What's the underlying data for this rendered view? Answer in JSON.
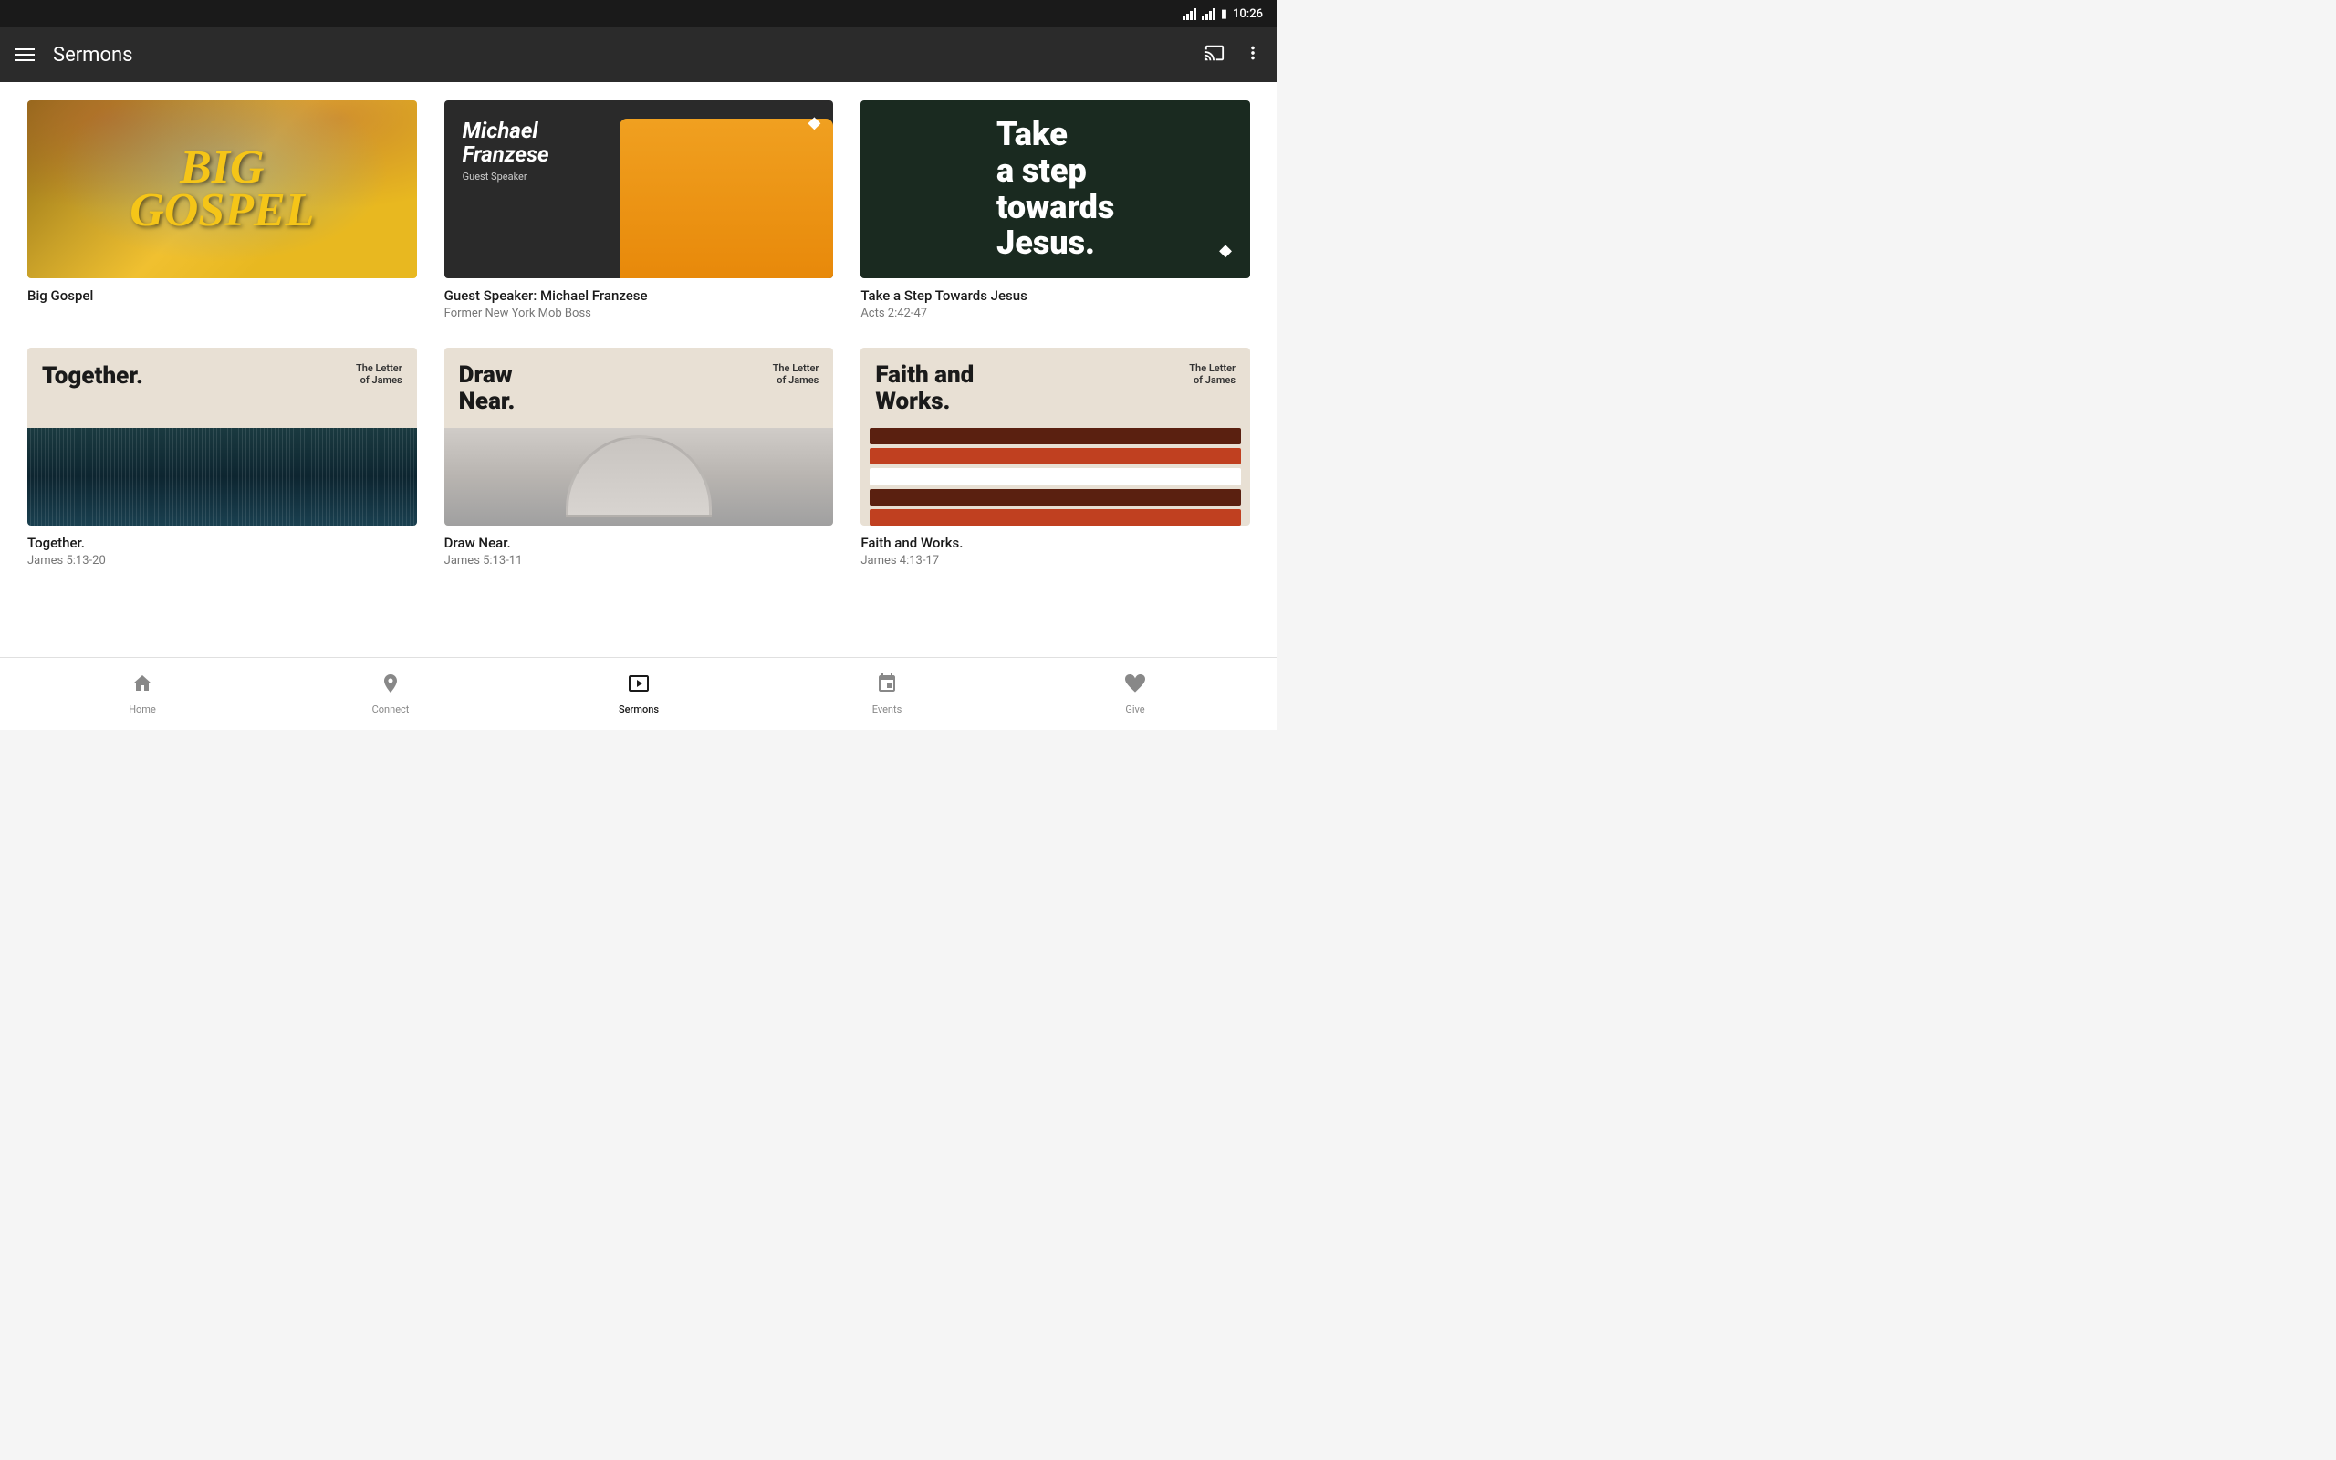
{
  "statusBar": {
    "time": "10:26"
  },
  "appBar": {
    "title": "Sermons",
    "menuIcon": "hamburger",
    "castIcon": "cast",
    "moreIcon": "more-vertical"
  },
  "sermons": [
    {
      "id": "big-gospel",
      "title": "Big Gospel",
      "subtitle": "",
      "thumbType": "big-gospel",
      "thumbText": "BIG\nGOSPEL"
    },
    {
      "id": "michael-franzese",
      "title": "Guest Speaker: Michael Franzese",
      "subtitle": "Former New York Mob Boss",
      "thumbType": "michael",
      "thumbName": "Michael\nFranzese",
      "thumbSub": "Guest Speaker"
    },
    {
      "id": "take-step-jesus",
      "title": "Take a Step Towards Jesus",
      "subtitle": "Acts 2:42-47",
      "thumbType": "step-jesus",
      "thumbText": "Take\na step\ntowards\nJesus."
    },
    {
      "id": "together",
      "title": "Together.",
      "subtitle": "James 5:13-20",
      "thumbType": "together",
      "thumbTitle": "Together.",
      "thumbSeries": "The Letter\nof James"
    },
    {
      "id": "draw-near",
      "title": "Draw Near.",
      "subtitle": "James 5:13-11",
      "thumbType": "draw-near",
      "thumbTitle": "Draw\nNear.",
      "thumbSeries": "The Letter\nof James"
    },
    {
      "id": "faith-works",
      "title": "Faith and Works.",
      "subtitle": "James 4:13-17",
      "thumbType": "faith-works",
      "thumbTitle": "Faith and\nWorks.",
      "thumbSeries": "The Letter\nof James"
    }
  ],
  "bottomNav": {
    "items": [
      {
        "id": "home",
        "label": "Home",
        "icon": "home",
        "active": false
      },
      {
        "id": "connect",
        "label": "Connect",
        "icon": "connect",
        "active": false
      },
      {
        "id": "sermons",
        "label": "Sermons",
        "icon": "play",
        "active": true
      },
      {
        "id": "events",
        "label": "Events",
        "icon": "events",
        "active": false
      },
      {
        "id": "give",
        "label": "Give",
        "icon": "give",
        "active": false
      }
    ]
  }
}
